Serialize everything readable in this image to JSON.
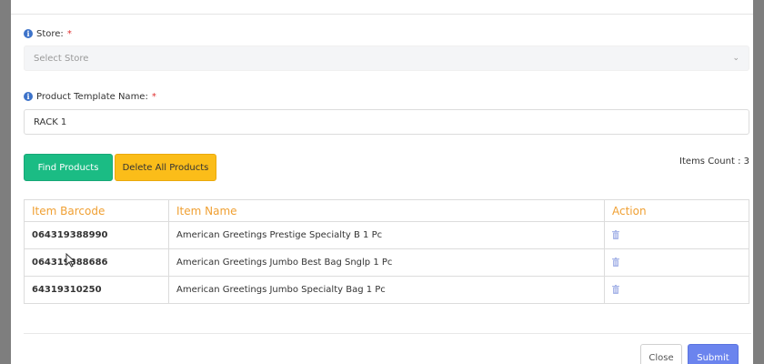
{
  "form": {
    "store": {
      "label": "Store:",
      "required_mark": "*",
      "placeholder": "Select Store"
    },
    "template_name": {
      "label": "Product Template Name:",
      "required_mark": "*",
      "value": "RACK 1"
    }
  },
  "actions": {
    "find_products": "Find Products",
    "delete_all": "Delete All Products",
    "items_count": "Items Count : 3"
  },
  "table": {
    "headers": {
      "barcode": "Item Barcode",
      "name": "Item Name",
      "action": "Action"
    },
    "rows": [
      {
        "barcode": "064319388990",
        "name": "American Greetings Prestige Specialty B 1 Pc"
      },
      {
        "barcode": "064319388686",
        "name": "American Greetings Jumbo Best Bag Snglp 1 Pc"
      },
      {
        "barcode": "64319310250",
        "name": "American Greetings Jumbo Specialty Bag 1 Pc"
      }
    ]
  },
  "footer": {
    "close": "Close",
    "submit": "Submit"
  },
  "colors": {
    "find_button": "#1bbc84",
    "delete_button": "#fbbd19",
    "header_text": "#f0a033",
    "submit_button": "#6b84ee",
    "info_icon": "#3c72c9",
    "required": "#e03030"
  },
  "icons": {
    "info": "info-icon",
    "select_arrow": "chevron-down-icon",
    "row_action": "trash-icon",
    "pointer": "mouse-cursor-icon"
  }
}
